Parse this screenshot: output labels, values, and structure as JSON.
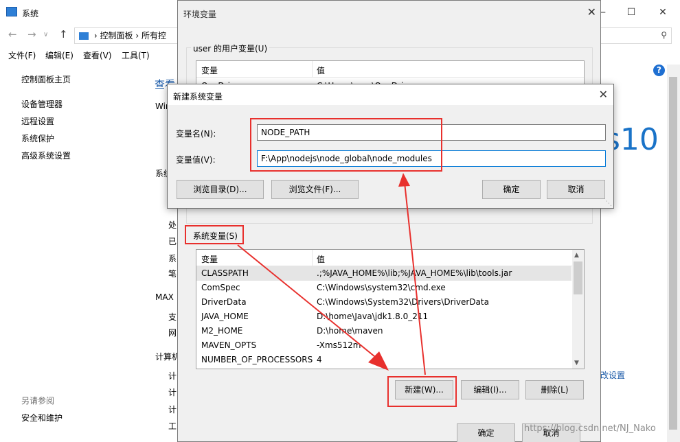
{
  "system_window": {
    "title": "系统",
    "breadcrumb": [
      "控制面板",
      "所有控"
    ],
    "menu": [
      "文件(F)",
      "编辑(E)",
      "查看(V)",
      "工具(T)"
    ],
    "sidebar": {
      "home": "控制面板主页",
      "links": [
        "设备管理器",
        "远程设置",
        "系统保护",
        "高级系统设置"
      ],
      "see_also_title": "另请参阅",
      "see_also": [
        "安全和维护"
      ]
    },
    "fragments": {
      "view": "查看",
      "win": "Wir",
      "sys": "系统",
      "chu": "处",
      "yi": "已",
      "xi": "系",
      "bi": "笔",
      "max": "MAX",
      "zhi": "支",
      "wang": "网",
      "computer": "计算机",
      "ji1": "计",
      "ji2": "计",
      "ji3": "计",
      "gong": "工",
      "settings": "改设置"
    },
    "win10_text": "s10",
    "help_label": "?"
  },
  "env_dialog": {
    "title": "环境变量",
    "user_group_label": "user 的用户变量(U)",
    "user_headers": [
      "变量",
      "值"
    ],
    "user_rows": [
      {
        "name": "OneDrive",
        "value": "C:\\Users\\user\\OneDrive"
      }
    ],
    "system_group_label": "系统变量(S)",
    "system_headers": [
      "变量",
      "值"
    ],
    "system_rows": [
      {
        "name": "CLASSPATH",
        "value": ".;%JAVA_HOME%\\lib;%JAVA_HOME%\\lib\\tools.jar"
      },
      {
        "name": "ComSpec",
        "value": "C:\\Windows\\system32\\cmd.exe"
      },
      {
        "name": "DriverData",
        "value": "C:\\Windows\\System32\\Drivers\\DriverData"
      },
      {
        "name": "JAVA_HOME",
        "value": "D:\\home\\Java\\jdk1.8.0_211"
      },
      {
        "name": "M2_HOME",
        "value": "D:\\home\\maven"
      },
      {
        "name": "MAVEN_OPTS",
        "value": "-Xms512m"
      },
      {
        "name": "NUMBER_OF_PROCESSORS",
        "value": "4"
      }
    ],
    "buttons": {
      "new": "新建(W)...",
      "edit": "编辑(I)...",
      "delete": "删除(L)"
    },
    "footer": {
      "ok": "确定",
      "cancel": "取消"
    }
  },
  "new_var_dialog": {
    "title": "新建系统变量",
    "name_label": "变量名(N):",
    "name_value": "NODE_PATH",
    "value_label": "变量值(V):",
    "value_value": "F:\\App\\nodejs\\node_global\\node_modules",
    "browse_dir": "浏览目录(D)...",
    "browse_file": "浏览文件(F)...",
    "ok": "确定",
    "cancel": "取消"
  },
  "annotation_color": "#e8302d",
  "watermark": "https://blog.csdn.net/NJ_Nako"
}
